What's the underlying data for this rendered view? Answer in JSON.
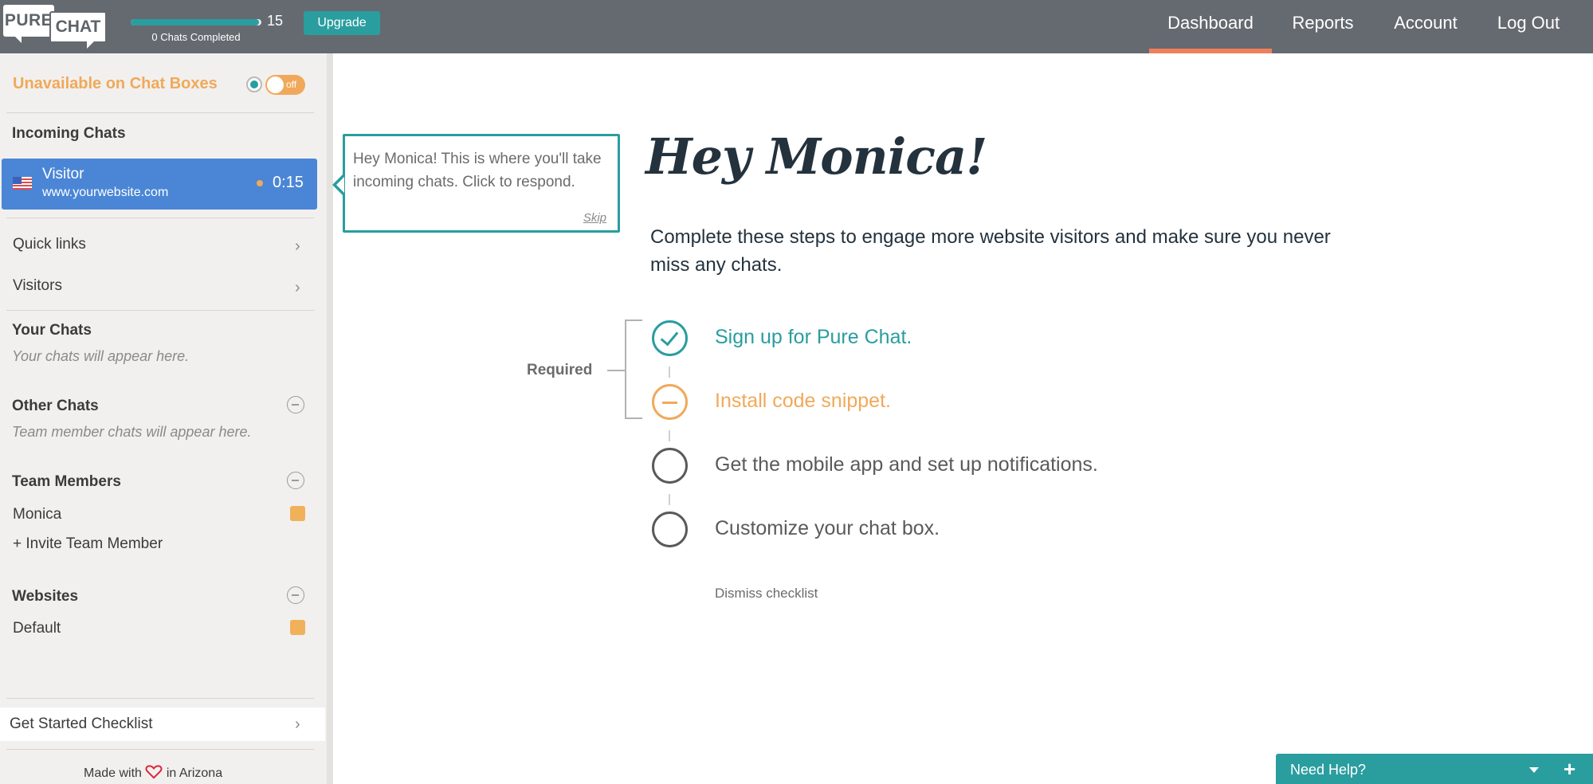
{
  "app": {
    "logo_top": "PURE",
    "logo_bottom": "CHAT",
    "chats_completed_count": "15",
    "chats_completed_label": "0 Chats Completed",
    "chats_progress_fraction": 0.98,
    "upgrade_label": "Upgrade"
  },
  "nav": {
    "items": [
      {
        "label": "Dashboard",
        "active": true
      },
      {
        "label": "Reports",
        "active": false
      },
      {
        "label": "Account",
        "active": false
      },
      {
        "label": "Log Out",
        "active": false
      }
    ]
  },
  "sidebar": {
    "availability_label": "Unavailable on Chat Boxes",
    "toggle_label": "off",
    "incoming_title": "Incoming Chats",
    "incoming_chat": {
      "name": "Visitor",
      "site": "www.yourwebsite.com",
      "time": "0:15",
      "flag": "us-flag-icon"
    },
    "quick_links_label": "Quick links",
    "visitors_label": "Visitors",
    "your_chats_title": "Your Chats",
    "your_chats_empty": "Your chats will appear here.",
    "other_chats_title": "Other Chats",
    "other_chats_empty": "Team member chats will appear here.",
    "team_members_title": "Team Members",
    "members": [
      {
        "name": "Monica",
        "color": "#f0b15a"
      }
    ],
    "invite_label": "+ Invite Team Member",
    "websites_title": "Websites",
    "websites": [
      {
        "name": "Default",
        "color": "#f0b15a"
      }
    ],
    "checklist_label": "Get Started Checklist",
    "made_with_prefix": "Made with",
    "made_with_suffix": "in Arizona"
  },
  "tooltip": {
    "text": "Hey Monica! This is where you'll take incoming chats. Click to respond.",
    "skip_label": "Skip"
  },
  "main": {
    "greeting": "Hey Monica!",
    "intro": "Complete these steps to engage more website visitors and make sure you never miss any chats.",
    "required_label": "Required",
    "steps": [
      {
        "label": "Sign up for Pure Chat.",
        "status": "done"
      },
      {
        "label": "Install code snippet.",
        "status": "pending"
      },
      {
        "label": "Get the mobile app and set up notifications.",
        "status": "todo"
      },
      {
        "label": "Customize your chat box.",
        "status": "todo"
      }
    ],
    "dismiss_label": "Dismiss checklist"
  },
  "help": {
    "label": "Need Help?"
  },
  "colors": {
    "topbar": "#656a70",
    "accent_teal": "#2a9d9f",
    "accent_orange": "#f0a95a",
    "active_tab": "#ef7f5a",
    "chat_blue": "#4b86d6"
  }
}
